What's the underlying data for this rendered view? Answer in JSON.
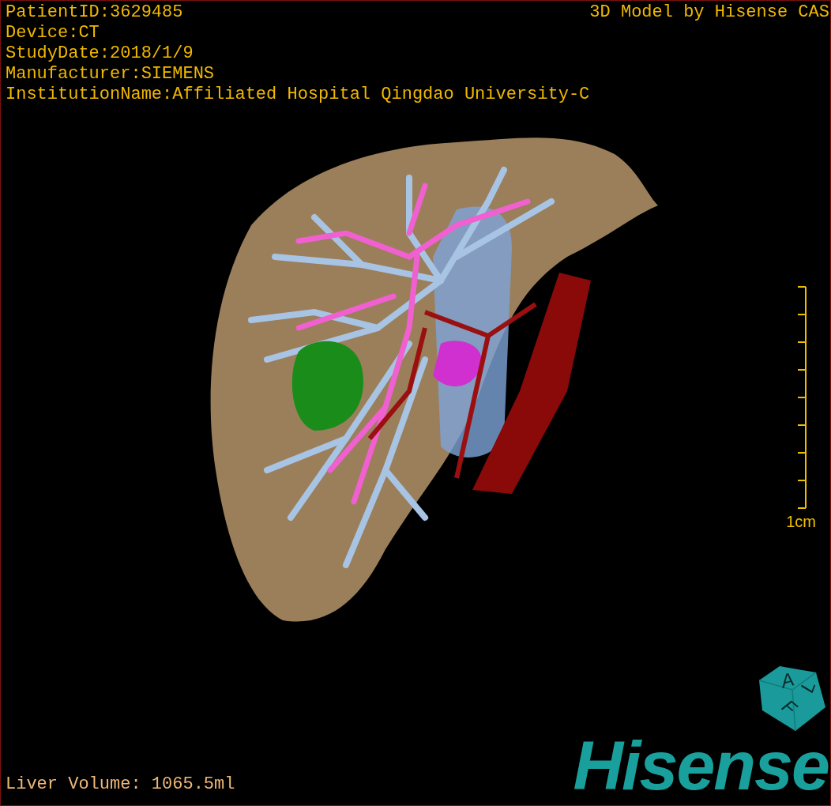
{
  "patient_info": [
    "PatientID:3629485",
    "Device:CT",
    "StudyDate:2018/1/9",
    "Manufacturer:SIEMENS",
    "InstitutionName:Affiliated Hospital Qingdao University-C"
  ],
  "credit": "3D Model by Hisense CAS",
  "scale_bar": {
    "label": "1cm"
  },
  "liver_volume": "Liver Volume: 1065.5ml",
  "logo": {
    "cube_letters": [
      "A",
      "L",
      "F"
    ],
    "wordmark": "Hisense"
  }
}
